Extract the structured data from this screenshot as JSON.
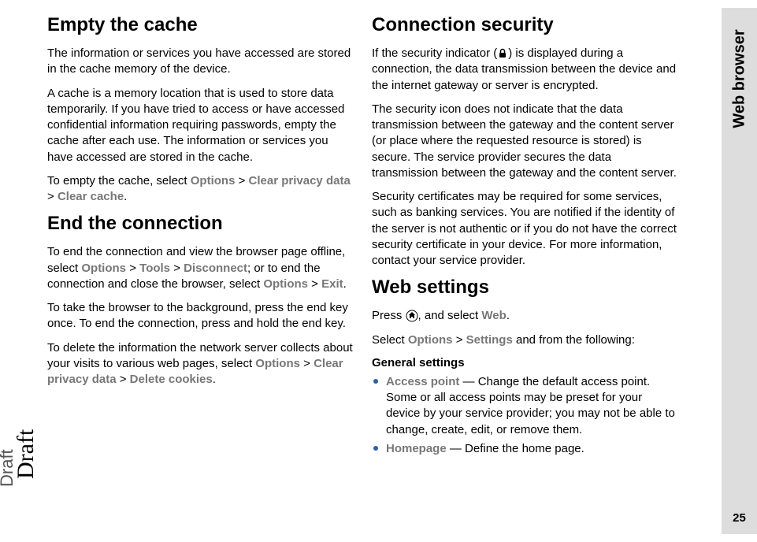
{
  "sideTab": "Web browser",
  "pageNumber": "25",
  "draftOuter": "Draft",
  "draftInner": "Draft",
  "left": {
    "h1": "Empty the cache",
    "p1": "The information or services you have accessed are stored in the cache memory of the device.",
    "p2": "A cache is a memory location that is used to store data temporarily. If you have tried to access or have accessed confidential information requiring passwords, empty the cache after each use. The information or services you have accessed are stored in the cache.",
    "p3_pre": "To empty the cache, select ",
    "p3_opt": "Options",
    "gt": " > ",
    "p3_clear": "Clear privacy data",
    "p3_cache": "Clear cache",
    "period": ".",
    "h2": "End the connection",
    "p4_pre": "To end the connection and view the browser page offline, select ",
    "p4_opt": "Options",
    "p4_tools": "Tools",
    "p4_disc": "Disconnect",
    "p4_mid": "; or to end the connection and close the browser, select ",
    "p4_opt2": "Options",
    "p4_exit": "Exit",
    "p5": "To take the browser to the background, press the end key once. To end the connection, press and hold the end key.",
    "p6_pre": "To delete the information the network server collects about your visits to various web pages, select ",
    "p6_opt": "Options",
    "p6_clear": "Clear privacy data",
    "p6_del": "Delete cookies"
  },
  "right": {
    "h1": "Connection security",
    "p1_pre": "If the security indicator (",
    "p1_post": ") is displayed during a connection, the data transmission between the device and the internet gateway or server is encrypted.",
    "p2": "The security icon does not indicate that the data transmission between the gateway and the content server (or place where the requested resource is stored) is secure. The service provider secures the data transmission between the gateway and the content server.",
    "p3": "Security certificates may be required for some services, such as banking services. You are notified if the identity of the server is not authentic or if you do not have the correct security certificate in your device. For more information, contact your service provider.",
    "h2": "Web settings",
    "p4_pre": "Press ",
    "p4_mid": ", and select ",
    "p4_web": "Web",
    "p5_pre": "Select ",
    "p5_opt": "Options",
    "p5_set": "Settings",
    "p5_post": " and from the following:",
    "sub1": "General settings",
    "b1_label": "Access point",
    "b1_text": " — Change the default access point. Some or all access points may be preset for your device by your service provider; you may not be able to change, create, edit, or remove them.",
    "b2_label": "Homepage",
    "b2_text": " — Define the home page."
  }
}
